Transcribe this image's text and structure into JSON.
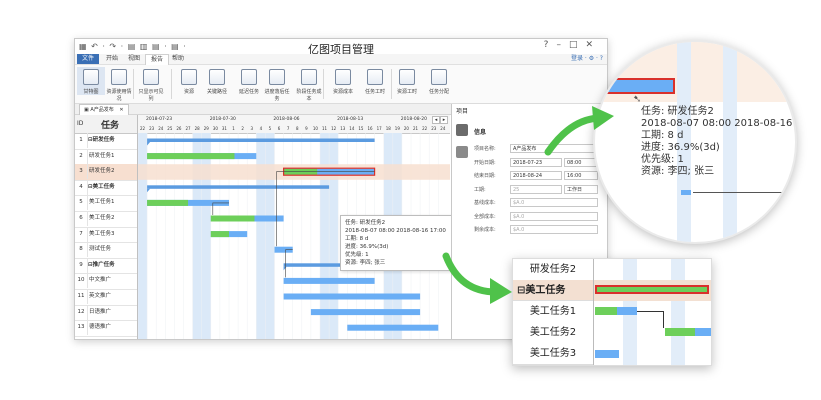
{
  "window": {
    "title": "亿图项目管理",
    "quick_access": "▦ ↶ · ↷ · ▤ ▥ ▤ · ▤ ·",
    "controls": [
      "?",
      "–",
      "□",
      "✕"
    ]
  },
  "menu": {
    "items": [
      "文件",
      "开始",
      "视图",
      "报告",
      "帮助"
    ],
    "login": "登录 · ⚙ · ?"
  },
  "ribbon": {
    "buttons": [
      "甘特图",
      "资源使用情况",
      "只显示可见列",
      "资源",
      "关键路径",
      "延迟任务",
      "进度落后任务",
      "阶段任务成本",
      "资源成本",
      "任务工时",
      "资源工时",
      "任务分配"
    ]
  },
  "doc_tab": {
    "label": "A产品发布",
    "close": "✕"
  },
  "grid": {
    "id_header": "ID",
    "task_header": "任务",
    "rows": [
      {
        "id": "1",
        "name": "⊟研发任务",
        "bold": true
      },
      {
        "id": "2",
        "name": "研发任务1"
      },
      {
        "id": "3",
        "name": "研发任务2",
        "selected": true
      },
      {
        "id": "4",
        "name": "⊟美工任务",
        "bold": true
      },
      {
        "id": "5",
        "name": "美工任务1"
      },
      {
        "id": "6",
        "name": "美工任务2"
      },
      {
        "id": "7",
        "name": "美工任务3"
      },
      {
        "id": "8",
        "name": "测试任务"
      },
      {
        "id": "9",
        "name": "⊟推广任务",
        "bold": true
      },
      {
        "id": "10",
        "name": "中文推广"
      },
      {
        "id": "11",
        "name": "英文推广"
      },
      {
        "id": "12",
        "name": "日语推广"
      },
      {
        "id": "13",
        "name": "德语推广"
      }
    ]
  },
  "timeline": {
    "weeks": [
      "2018-07-23",
      "2018-07-30",
      "2018-08-06",
      "2018-08-13",
      "2018-08-20"
    ],
    "days": [
      "22",
      "23",
      "24",
      "25",
      "26",
      "27",
      "28",
      "29",
      "30",
      "31",
      "1",
      "2",
      "3",
      "4",
      "5",
      "6",
      "7",
      "8",
      "9",
      "10",
      "11",
      "12",
      "13",
      "14",
      "15",
      "16",
      "17",
      "18",
      "19",
      "20",
      "21",
      "22",
      "23",
      "24"
    ],
    "nav": [
      "◂",
      "▸"
    ]
  },
  "tooltip": {
    "task": "任务:  研发任务2",
    "dates": "2018-08-07 08:00  2018-08-16 17:00",
    "work": "工期:  8 d",
    "progress": "进度:  36.9%(3d)",
    "priority": "优先级:  1",
    "resource": "资源:  李四; 张三"
  },
  "properties": {
    "panel_title": "项目",
    "section": "信息",
    "fields": [
      {
        "label": "项目名称:",
        "value": "A产品发布"
      },
      {
        "label": "开始日期:",
        "value": "2018-07-23",
        "time": "08:00"
      },
      {
        "label": "结束日期:",
        "value": "2018-08-24",
        "time": "16:00"
      },
      {
        "label": "工期:",
        "value": "25",
        "unit": "工作日"
      },
      {
        "label": "基线成本:",
        "value": "$A.0"
      },
      {
        "label": "全部成本:",
        "value": "$A.0"
      },
      {
        "label": "剩余成本:",
        "value": "$A.0"
      }
    ]
  },
  "zoom_top": {
    "task": "任务:  研发任务2",
    "dates": "2018-08-07 08:00  2018-08-16",
    "work": "工期:   8 d",
    "progress": "进度:  36.9%(3d)",
    "priority": "优先级:   1",
    "resource": "资源:  李四; 张三"
  },
  "zoom_bottom": {
    "rows": [
      "研发任务2",
      "⊟美工任务",
      "美工任务1",
      "美工任务2",
      "美工任务3"
    ]
  },
  "colors": {
    "green": "#6dcf5a",
    "blue": "#6aaef5",
    "selected_row": "#f7dfd0",
    "highlight_col": "#dbe9f8",
    "red_outline": "#d9302b",
    "arrow": "#4fc24a"
  },
  "chart_data": {
    "type": "gantt",
    "tasks": [
      {
        "name": "研发任务",
        "summary": true,
        "start": "2018-07-23",
        "end": "2018-08-16"
      },
      {
        "name": "研发任务1",
        "start": "2018-07-23",
        "end": "2018-08-03",
        "progress": 0.8
      },
      {
        "name": "研发任务2",
        "start": "2018-08-07",
        "end": "2018-08-16",
        "progress": 0.369
      },
      {
        "name": "美工任务",
        "summary": true,
        "start": "2018-07-23",
        "end": "2018-08-11"
      },
      {
        "name": "美工任务1",
        "start": "2018-07-23",
        "end": "2018-07-31",
        "progress": 0.5
      },
      {
        "name": "美工任务2",
        "start": "2018-07-30",
        "end": "2018-08-06",
        "progress": 0.6
      },
      {
        "name": "美工任务3",
        "start": "2018-07-30",
        "end": "2018-08-02",
        "progress": 0.5
      },
      {
        "name": "测试任务",
        "start": "2018-08-06",
        "end": "2018-08-07",
        "progress": 0
      },
      {
        "name": "推广任务",
        "summary": true,
        "start": "2018-08-07",
        "end": "2018-08-24"
      },
      {
        "name": "中文推广",
        "start": "2018-08-07",
        "end": "2018-08-16",
        "progress": 0
      },
      {
        "name": "英文推广",
        "start": "2018-08-07",
        "end": "2018-08-21",
        "progress": 0
      },
      {
        "name": "日语推广",
        "start": "2018-08-10",
        "end": "2018-08-21",
        "progress": 0
      },
      {
        "name": "德语推广",
        "start": "2018-08-14",
        "end": "2018-08-23",
        "progress": 0
      }
    ],
    "axis_start": "2018-07-22"
  }
}
